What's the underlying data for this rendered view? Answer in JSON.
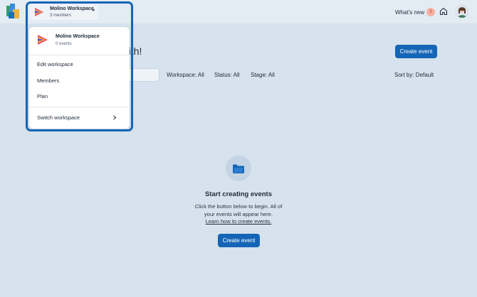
{
  "topbar": {
    "whats_new_label": "What's new",
    "whats_new_count": "5",
    "icons": [
      "app-logo-icon",
      "home-icon",
      "avatar"
    ]
  },
  "workspace": {
    "name": "Molino Workspace",
    "members_count": "3 members",
    "events_count": "0 events"
  },
  "dropdown": {
    "items": [
      "Edit workspace",
      "Members",
      "Plan"
    ],
    "switch_label": "Switch workspace"
  },
  "main": {
    "heading_fragment": "rith!",
    "create_event_label": "Create event",
    "filters": {
      "workspace": "Workspace: All",
      "status": "Status: All",
      "stage": "Stage: All",
      "sort": "Sort by: Default"
    },
    "empty": {
      "title": "Start creating events",
      "line1": "Click the button below to begin. All of",
      "line2": "your events will appear here.",
      "link": "Learn how to create events.",
      "button": "Create event"
    }
  },
  "colors": {
    "accent": "#1565b6",
    "background": "#d6e2ed",
    "topbar": "#e3ebf3"
  }
}
